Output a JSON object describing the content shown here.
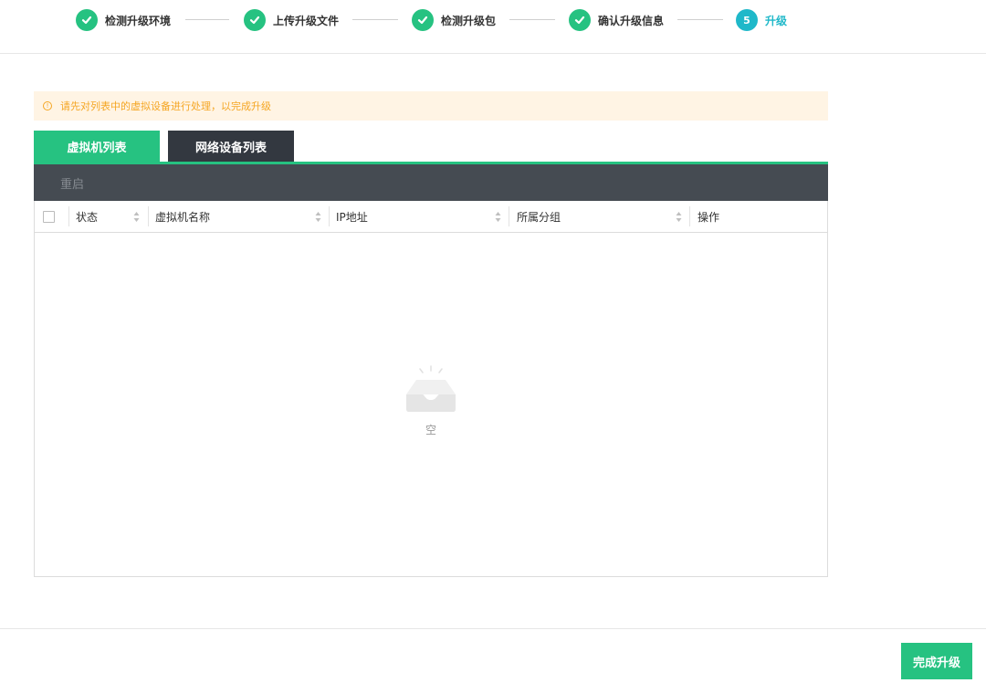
{
  "steps": [
    {
      "label": "检测升级环境",
      "status": "done"
    },
    {
      "label": "上传升级文件",
      "status": "done"
    },
    {
      "label": "检测升级包",
      "status": "done"
    },
    {
      "label": "确认升级信息",
      "status": "done"
    },
    {
      "label": "升级",
      "status": "active",
      "number": "5"
    }
  ],
  "alert": {
    "icon": "info-icon",
    "text": "请先对列表中的虚拟设备进行处理，以完成升级"
  },
  "tabs": [
    {
      "label": "虚拟机列表",
      "active": true
    },
    {
      "label": "网络设备列表",
      "active": false
    }
  ],
  "toolbar": {
    "restart_label": "重启"
  },
  "table": {
    "columns": [
      "状态",
      "虚拟机名称",
      "IP地址",
      "所属分组",
      "操作"
    ],
    "rows": []
  },
  "empty": {
    "text": "空",
    "icon": "empty-inbox-icon"
  },
  "footer": {
    "finish_label": "完成升级"
  },
  "colors": {
    "primary": "#26c281",
    "active_step": "#1fb8c9",
    "warning": "#f5a623",
    "dark": "#454b52"
  }
}
